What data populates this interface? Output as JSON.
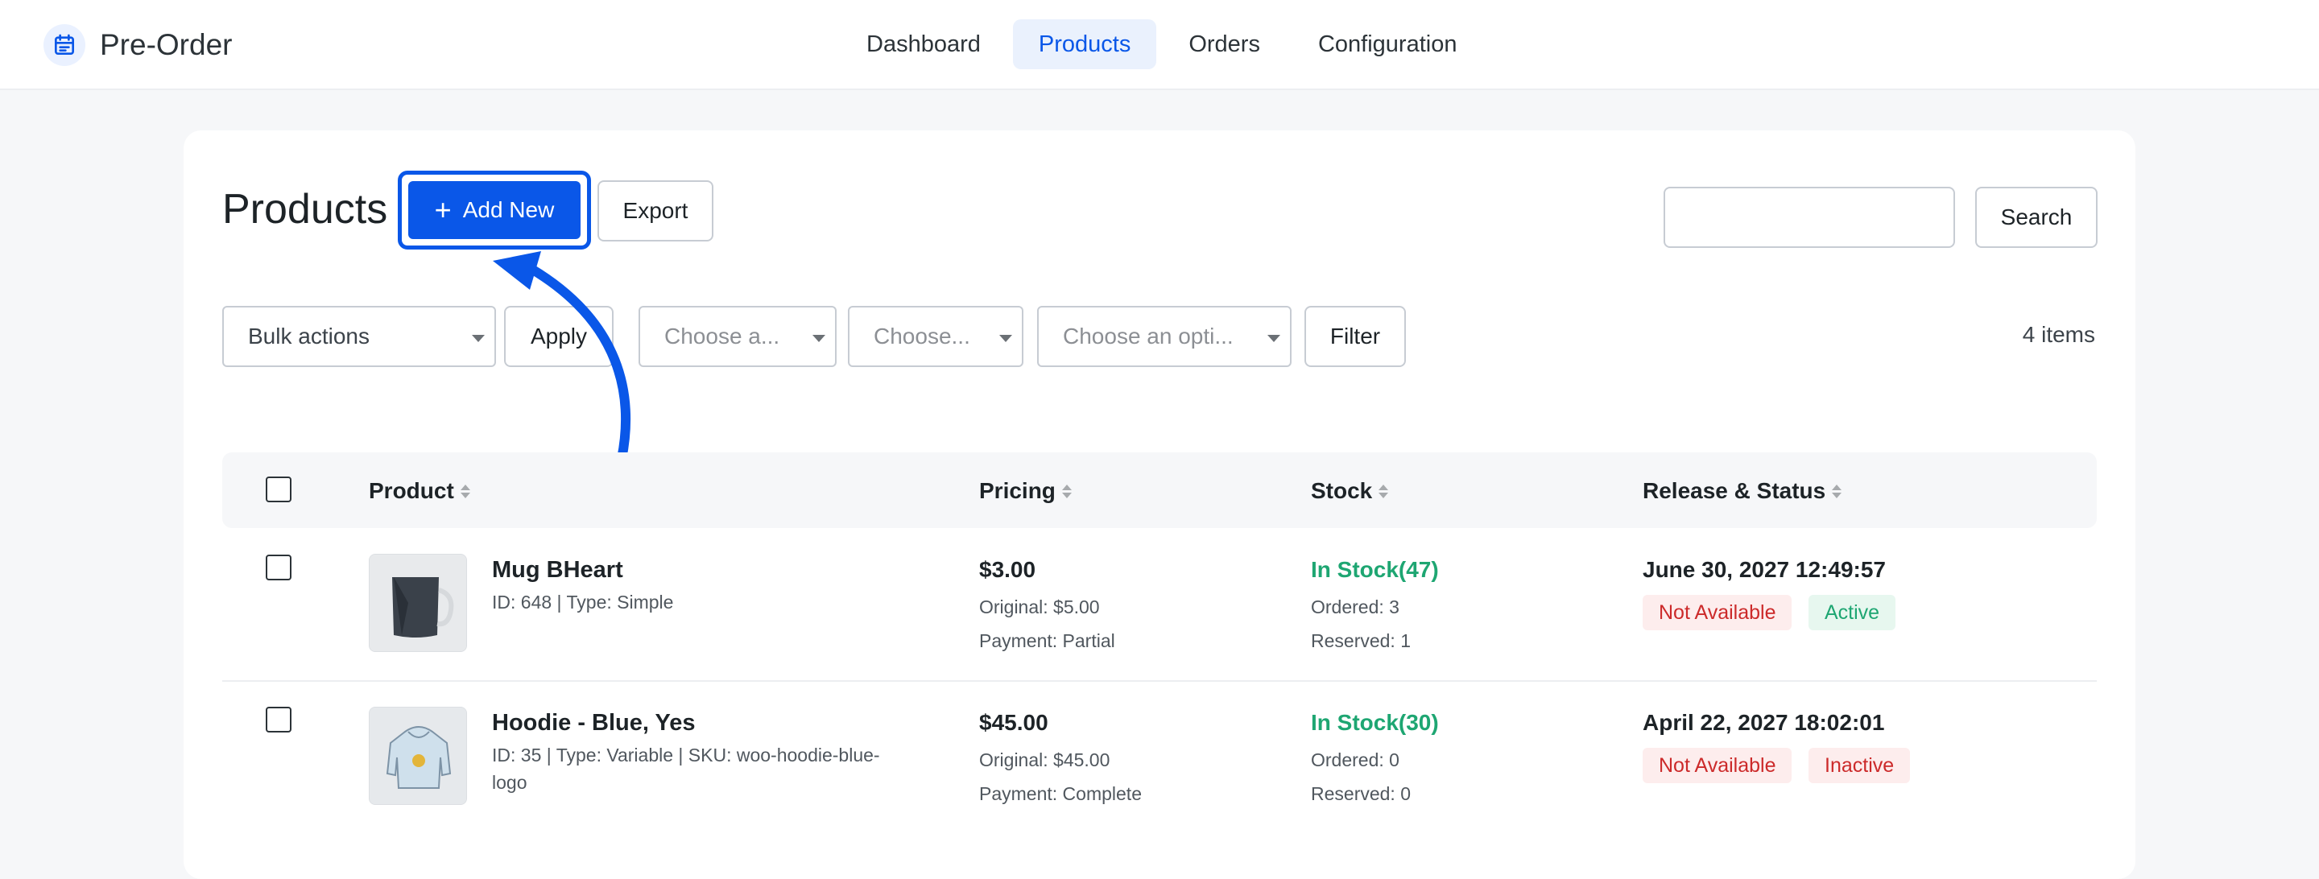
{
  "app": {
    "title": "Pre-Order",
    "nav": [
      "Dashboard",
      "Products",
      "Orders",
      "Configuration"
    ],
    "active_nav": "Products"
  },
  "page": {
    "title": "Products",
    "add_new_label": "Add New",
    "export_label": "Export",
    "search_button_label": "Search",
    "search_value": "",
    "bulk_actions": "Bulk actions",
    "apply_label": "Apply",
    "filter1_placeholder": "Choose a...",
    "filter2_placeholder": "Choose...",
    "filter3_placeholder": "Choose an opti...",
    "filter_label": "Filter",
    "items_count": "4 items"
  },
  "table": {
    "headers": [
      "Product",
      "Pricing",
      "Stock",
      "Release & Status"
    ],
    "rows": [
      {
        "name": "Mug BHeart",
        "meta": "ID: 648 | Type: Simple",
        "price": "$3.00",
        "original": "Original: $5.00",
        "payment": "Payment: Partial",
        "stock": "In Stock(47)",
        "ordered": "Ordered: 3",
        "reserved": "Reserved: 1",
        "release": "June 30, 2027 12:49:57",
        "availability": "Not Available",
        "status": "Active",
        "thumb_icon": "mug-image"
      },
      {
        "name": "Hoodie - Blue, Yes",
        "meta": "ID: 35 | Type: Variable | SKU: woo-hoodie-blue-logo",
        "price": "$45.00",
        "original": "Original: $45.00",
        "payment": "Payment: Complete",
        "stock": "In Stock(30)",
        "ordered": "Ordered: 0",
        "reserved": "Reserved: 0",
        "release": "April 22, 2027 18:02:01",
        "availability": "Not Available",
        "status": "Inactive",
        "thumb_icon": "hoodie-image"
      }
    ]
  },
  "colors": {
    "accent": "#0a57e8",
    "success": "#1ea672",
    "danger": "#cc2a2a"
  }
}
